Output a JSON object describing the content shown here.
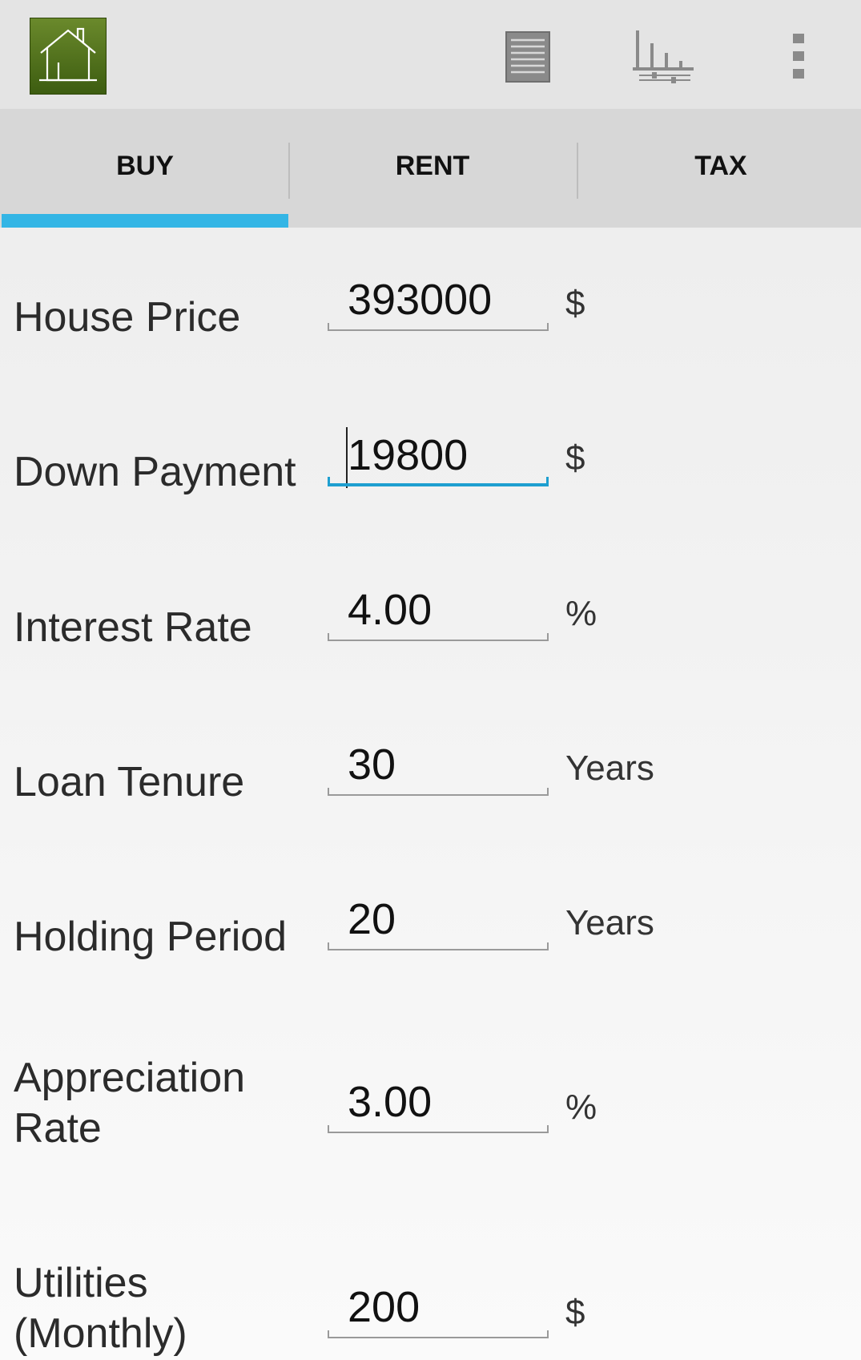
{
  "action_bar": {
    "app_icon": "house-icon",
    "actions": [
      {
        "name": "list-icon"
      },
      {
        "name": "chart-icon"
      },
      {
        "name": "overflow-menu-icon"
      }
    ]
  },
  "tabs": [
    {
      "label": "BUY",
      "selected": true
    },
    {
      "label": "RENT",
      "selected": false
    },
    {
      "label": "TAX",
      "selected": false
    }
  ],
  "accent_color": "#33b5e5",
  "app_icon_color": "#4f6f1c",
  "form": {
    "house_price": {
      "label": "House Price",
      "value": "393000",
      "unit": "$"
    },
    "down_payment": {
      "label": "Down Payment",
      "value": "19800",
      "unit": "$"
    },
    "interest_rate": {
      "label": "Interest Rate",
      "value": "4.00",
      "unit": "%"
    },
    "loan_tenure": {
      "label": "Loan Tenure",
      "value": "30",
      "unit": "Years"
    },
    "holding_period": {
      "label": "Holding Period",
      "value": "20",
      "unit": "Years"
    },
    "appreciation_rate": {
      "label_line1": "Appreciation",
      "label_line2": "Rate",
      "value": "3.00",
      "unit": "%"
    },
    "utilities": {
      "label_line1": "Utilities",
      "label_line2": "(Monthly)",
      "value": "200",
      "unit": "$"
    }
  }
}
